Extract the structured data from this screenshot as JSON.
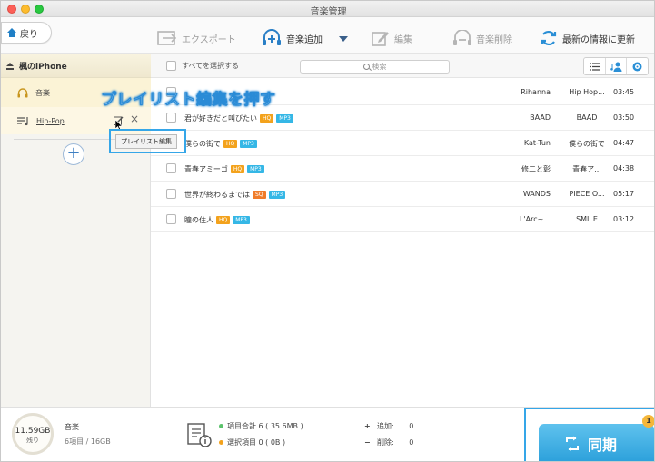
{
  "window": {
    "title": "音楽管理"
  },
  "toolbar": {
    "back_label": "戻り",
    "export_label": "エクスポート",
    "add_label": "音楽追加",
    "edit_label": "編集",
    "delete_label": "音楽削除",
    "refresh_label": "最新の情報に更新"
  },
  "sidebar": {
    "device_name": "楓のiPhone",
    "music_label": "音楽",
    "playlist_name": "Hip-Pop"
  },
  "annotation": {
    "instruction": "プレイリスト編集を押す",
    "tooltip": "プレイリスト編集"
  },
  "list": {
    "select_all_label": "すべてを選択する",
    "search_placeholder": "検索",
    "rows": [
      {
        "title": "",
        "badges": [],
        "artist": "Rihanna",
        "album": "Hip Hop...",
        "duration": "03:45"
      },
      {
        "title": "君が好きだと叫びたい",
        "badges": [
          {
            "text": "HQ",
            "color": "#f3a21c"
          },
          {
            "text": "MP3",
            "color": "#35b7e6"
          }
        ],
        "artist": "BAAD",
        "album": "BAAD",
        "duration": "03:50"
      },
      {
        "title": "僕らの街で",
        "badges": [
          {
            "text": "HQ",
            "color": "#f3a21c"
          },
          {
            "text": "MP3",
            "color": "#35b7e6"
          }
        ],
        "artist": "Kat-Tun",
        "album": "僕らの街で",
        "duration": "04:47"
      },
      {
        "title": "青春アミーゴ",
        "badges": [
          {
            "text": "HQ",
            "color": "#f3a21c"
          },
          {
            "text": "MP3",
            "color": "#35b7e6"
          }
        ],
        "artist": "修二と彰",
        "album": "青春ア...",
        "duration": "04:38"
      },
      {
        "title": "世界が終わるまでは",
        "badges": [
          {
            "text": "SQ",
            "color": "#f07c2a"
          },
          {
            "text": "MP3",
            "color": "#35b7e6"
          }
        ],
        "artist": "WANDS",
        "album": "PIECE O...",
        "duration": "05:17"
      },
      {
        "title": "瞳の住人",
        "badges": [
          {
            "text": "HQ",
            "color": "#f3a21c"
          },
          {
            "text": "MP3",
            "color": "#35b7e6"
          }
        ],
        "artist": "L'Arc~...",
        "album": "SMILE",
        "duration": "03:12"
      }
    ]
  },
  "footer": {
    "storage_free": "11.59GB",
    "storage_free_label": "残り",
    "category": "音楽",
    "count_summary": "6項目 / 16GB",
    "total_items": "項目合計 6 ( 35.6MB )",
    "selected_items": "選択項目 0 ( 0B )",
    "add_label": "追加:",
    "add_count": "0",
    "delete_label": "削除:",
    "delete_count": "0",
    "sync_label": "同期",
    "sync_badge": "1"
  },
  "colors": {
    "accent": "#2a9fda",
    "sidebar_selected": "#fbf3d6",
    "annotation_blue": "#35a6e8"
  }
}
